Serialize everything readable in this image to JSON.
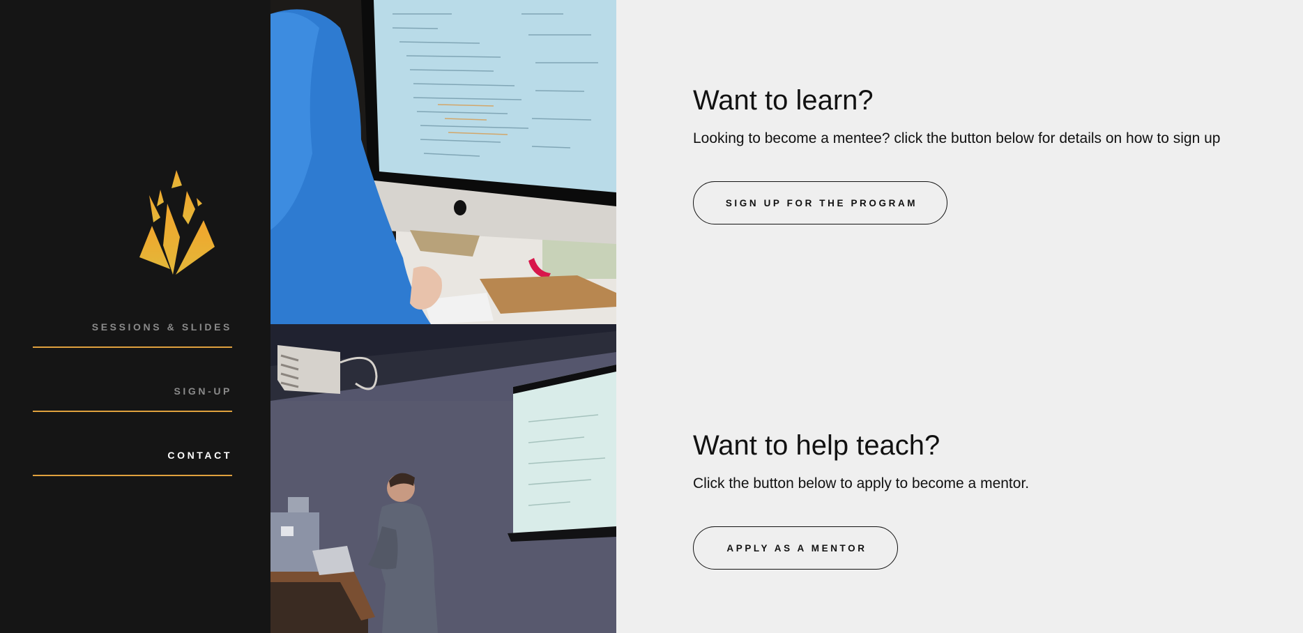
{
  "nav": {
    "items": [
      {
        "label": "SESSIONS & SLIDES"
      },
      {
        "label": "SIGN-UP"
      },
      {
        "label": "CONTACT"
      }
    ]
  },
  "learn": {
    "heading": "Want to learn?",
    "text": "Looking to become a mentee? click the button below for details on how to sign up",
    "button": "SIGN UP FOR THE PROGRAM"
  },
  "teach": {
    "heading": "Want to help teach?",
    "text": "Click the button below to apply to become a mentor.",
    "button": "APPLY AS A MENTOR"
  },
  "colors": {
    "sidebar": "#151515",
    "accent": "#e0a13e",
    "page_background": "#efefef"
  }
}
